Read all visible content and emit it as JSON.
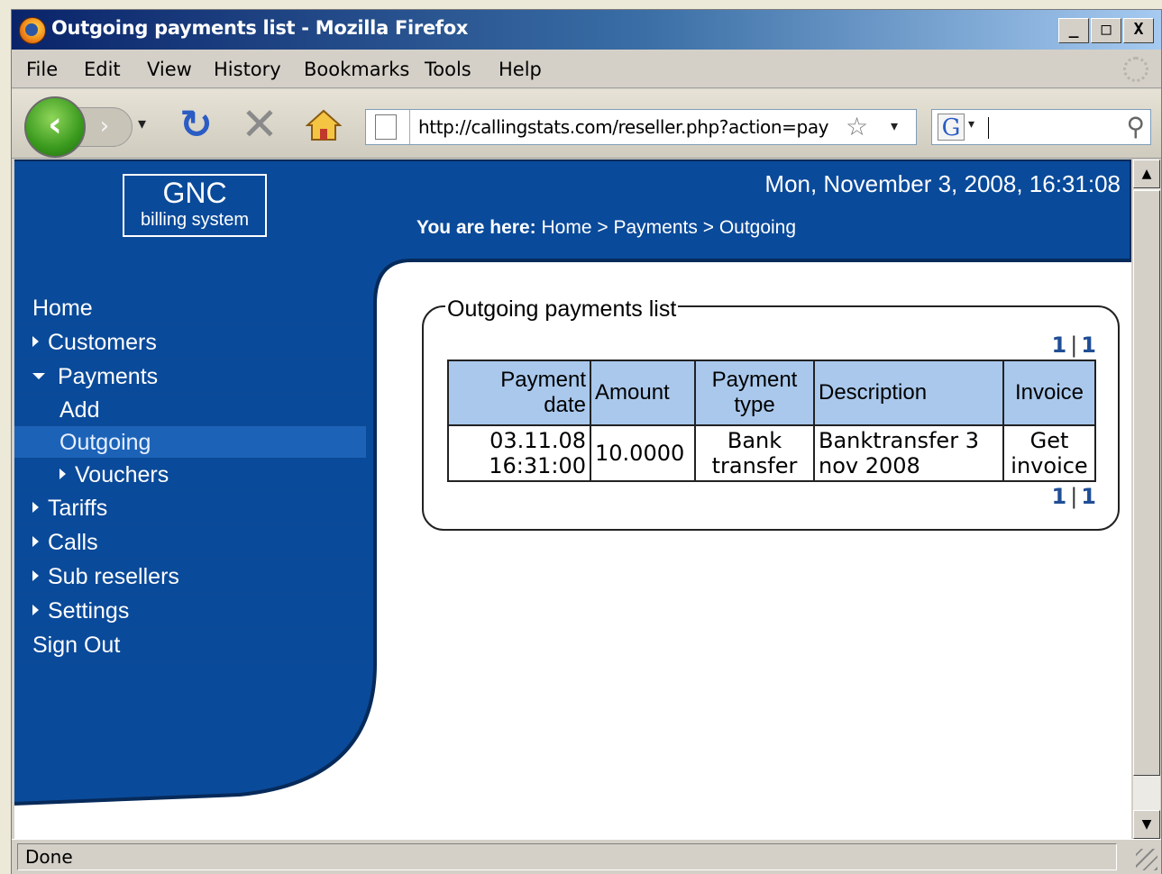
{
  "window": {
    "title": "Outgoing payments list - Mozilla Firefox",
    "buttons": {
      "minimize": "_",
      "maximize": "□",
      "close": "X"
    }
  },
  "menu": [
    "File",
    "Edit",
    "View",
    "History",
    "Bookmarks",
    "Tools",
    "Help"
  ],
  "toolbar": {
    "url": "http://callingstats.com/reseller.php?action=pay",
    "search_value": ""
  },
  "header": {
    "logo_line1": "GNC",
    "logo_line2": "billing system",
    "datetime": "Mon, November 3, 2008, 16:31:08",
    "breadcrumb_label": "You are here:",
    "breadcrumb": [
      "Home",
      "Payments",
      "Outgoing"
    ],
    "breadcrumb_sep": ">"
  },
  "sidebar": {
    "items": [
      {
        "label": "Home",
        "arrow": "none",
        "level": 0,
        "active": false
      },
      {
        "label": "Customers",
        "arrow": "right",
        "level": 0,
        "active": false
      },
      {
        "label": "Payments",
        "arrow": "down",
        "level": 0,
        "active": false
      },
      {
        "label": "Add",
        "arrow": "none",
        "level": 1,
        "active": false
      },
      {
        "label": "Outgoing",
        "arrow": "none",
        "level": 1,
        "active": true
      },
      {
        "label": "Vouchers",
        "arrow": "right",
        "level": 1,
        "active": false
      },
      {
        "label": "Tariffs",
        "arrow": "right",
        "level": 0,
        "active": false
      },
      {
        "label": "Calls",
        "arrow": "right",
        "level": 0,
        "active": false
      },
      {
        "label": "Sub resellers",
        "arrow": "right",
        "level": 0,
        "active": false
      },
      {
        "label": "Settings",
        "arrow": "right",
        "level": 0,
        "active": false
      },
      {
        "label": "Sign Out",
        "arrow": "none",
        "level": 0,
        "active": false
      }
    ]
  },
  "main": {
    "legend": "Outgoing payments list",
    "pager": {
      "current": "1",
      "sep": "|",
      "total": "1"
    },
    "columns": [
      {
        "label": "Payment date",
        "align": "right"
      },
      {
        "label": "Amount",
        "align": "left"
      },
      {
        "label": "Payment type",
        "align": "center"
      },
      {
        "label": "Description",
        "align": "left"
      },
      {
        "label": "Invoice",
        "align": "center"
      }
    ],
    "rows": [
      {
        "date": "03.11.08 16:31:00",
        "amount": "10.0000",
        "type": "Bank transfer",
        "description": "Banktransfer 3 nov 2008",
        "invoice": "Get invoice"
      }
    ]
  },
  "status": "Done",
  "colors": {
    "brand_blue": "#0a4a9a",
    "header_cell": "#a9c8ec",
    "pager_link": "#1f4e96"
  }
}
